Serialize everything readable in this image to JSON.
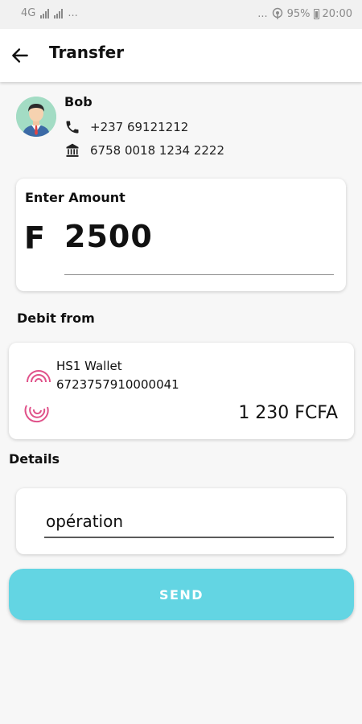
{
  "status_bar": {
    "network": "4G",
    "dots_left": "...",
    "dots_right": "...",
    "battery": "95%",
    "time": "20:00"
  },
  "app_bar": {
    "title": "Transfer",
    "back_icon": "arrow-left-icon"
  },
  "recipient": {
    "name": "Bob",
    "phone": "+237 69121212",
    "account": "6758 0018 1234 2222",
    "icons": [
      "avatar",
      "phone-icon",
      "bank-icon"
    ]
  },
  "amount": {
    "label": "Enter Amount",
    "currency_symbol": "F",
    "value": "2500"
  },
  "debit": {
    "label": "Debit from",
    "wallet_name": "HS1 Wallet",
    "wallet_number": "6723757910000041",
    "balance": "1 230 FCFA"
  },
  "details": {
    "label": "Details",
    "value": "opération"
  },
  "send_button": {
    "label": "SEND"
  },
  "colors": {
    "accent": "#63d5e3",
    "wallet_logo": "#e0528a",
    "avatar_bg": "#a3dcc4"
  }
}
